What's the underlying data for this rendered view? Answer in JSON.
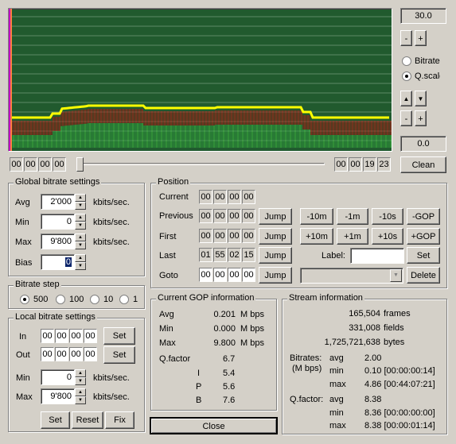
{
  "graph": {
    "bg": "#215a2e",
    "lines": "#9bb89f"
  },
  "scale": {
    "value": "30.0",
    "minus": "-",
    "plus": "+"
  },
  "mode": {
    "bitrate": "Bitrate",
    "qscale": "Q.scale",
    "selected": "qscale"
  },
  "nav": {
    "up": "▲",
    "down": "▼",
    "minus": "-",
    "plus": "+"
  },
  "offset": {
    "value": "0.0",
    "clean": "Clean"
  },
  "timeline": {
    "start": [
      "00",
      "00",
      "00",
      "00"
    ],
    "end": [
      "00",
      "00",
      "19",
      "23"
    ]
  },
  "global": {
    "title": "Global bitrate settings",
    "avg_label": "Avg",
    "avg": "2'000",
    "min_label": "Min",
    "min": "0",
    "max_label": "Max",
    "max": "9'800",
    "bias_label": "Bias",
    "bias": "0",
    "unit": "kbits/sec."
  },
  "step": {
    "title": "Bitrate step",
    "options": [
      "500",
      "100",
      "10",
      "1"
    ],
    "selected": "500"
  },
  "local": {
    "title": "Local bitrate settings",
    "in_label": "In",
    "in": [
      "00",
      "00",
      "00",
      "00"
    ],
    "out_label": "Out",
    "out": [
      "00",
      "00",
      "00",
      "00"
    ],
    "set": "Set",
    "min_label": "Min",
    "min": "0",
    "max_label": "Max",
    "max": "9'800",
    "unit": "kbits/sec.",
    "btn_set": "Set",
    "btn_reset": "Reset",
    "btn_fix": "Fix"
  },
  "position": {
    "title": "Position",
    "current_label": "Current",
    "current": [
      "00",
      "00",
      "00",
      "00"
    ],
    "previous_label": "Previous",
    "previous": [
      "00",
      "00",
      "00",
      "00"
    ],
    "first_label": "First",
    "first": [
      "00",
      "00",
      "00",
      "00"
    ],
    "last_label": "Last",
    "last": [
      "01",
      "55",
      "02",
      "15"
    ],
    "goto_label": "Goto",
    "goto": [
      "00",
      "00",
      "00",
      "00"
    ],
    "jump": "Jump",
    "nav_row1": [
      "-10m",
      "-1m",
      "-10s",
      "-GOP"
    ],
    "nav_row2": [
      "+10m",
      "+1m",
      "+10s",
      "+GOP"
    ],
    "label_text": "Label:",
    "label_value": "",
    "set": "Set",
    "delete": "Delete"
  },
  "gop": {
    "title": "Current GOP information",
    "avg_label": "Avg",
    "avg": "0.201",
    "avg_unit": "M bps",
    "min_label": "Min",
    "min": "0.000",
    "min_unit": "M bps",
    "max_label": "Max",
    "max": "9.800",
    "max_unit": "M bps",
    "qfactor_label": "Q.factor",
    "qfactor": "6.7",
    "i_label": "I",
    "i": "5.4",
    "p_label": "P",
    "p": "5.6",
    "b_label": "B",
    "b": "7.6"
  },
  "stream": {
    "title": "Stream information",
    "frames": "165,504",
    "frames_label": "frames",
    "fields": "331,008",
    "fields_label": "fields",
    "bytes": "1,725,721,638",
    "bytes_label": "bytes",
    "bitrates_label": "Bitrates:",
    "mbps_label": "(M bps)",
    "br_avg_label": "avg",
    "br_avg": "2.00",
    "br_min_label": "min",
    "br_min": "0.10 [00:00:00:14]",
    "br_max_label": "max",
    "br_max": "4.86 [00:44:07:21]",
    "qf_label": "Q.factor:",
    "qf_avg_label": "avg",
    "qf_avg": "8.38",
    "qf_min_label": "min",
    "qf_min": "8.36 [00:00:00:00]",
    "qf_max_label": "max",
    "qf_max": "8.38 [00:00:01:14]"
  },
  "close": "Close"
}
